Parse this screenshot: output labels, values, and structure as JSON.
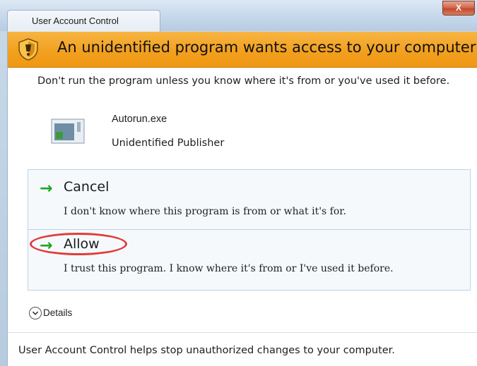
{
  "window": {
    "title": "User Account Control",
    "close_label": "X"
  },
  "banner": {
    "text": "An unidentified program wants access to your computer",
    "icon": "security-shield-icon",
    "color": "#f2a01f"
  },
  "warning": {
    "text": "Don't run the program unless you know where it's from or you've used it before."
  },
  "program": {
    "icon": "application-icon",
    "name": "Autorun.exe",
    "publisher": "Unidentified Publisher"
  },
  "options": {
    "cancel": {
      "icon": "green-arrow-icon",
      "label": "Cancel",
      "description": "I don't know where this program is from or what it's for."
    },
    "allow": {
      "icon": "green-arrow-icon",
      "label": "Allow",
      "description": "I trust this program.  I know where it's from or I've used it before.",
      "highlight_color": "#e23b3b"
    }
  },
  "details": {
    "icon": "chevron-down-icon",
    "label": "Details"
  },
  "footer": {
    "text": "User Account Control helps stop unauthorized changes to your computer."
  }
}
